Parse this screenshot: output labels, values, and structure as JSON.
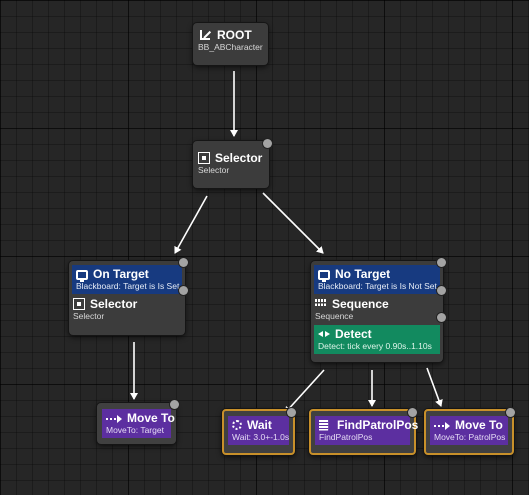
{
  "nodes": {
    "root": {
      "title": "ROOT",
      "subtitle": "BB_ABCharacter",
      "icon": "root-icon"
    },
    "selector_main": {
      "title": "Selector",
      "subtitle": "Selector",
      "icon": "selector-icon"
    },
    "left_branch": {
      "decorator": {
        "title": "On Target",
        "subtitle": "Blackboard: Target is Is Set",
        "icon": "blackboard-icon"
      },
      "composite": {
        "title": "Selector",
        "subtitle": "Selector",
        "icon": "selector-icon"
      }
    },
    "right_branch": {
      "decorator": {
        "title": "No Target",
        "subtitle": "Blackboard: Target is Is Not Set",
        "icon": "blackboard-icon"
      },
      "composite": {
        "title": "Sequence",
        "subtitle": "Sequence",
        "icon": "sequence-icon"
      },
      "service": {
        "title": "Detect",
        "subtitle": "Detect: tick every 0.90s..1.10s",
        "icon": "service-icon"
      }
    },
    "tasks": {
      "move_to_target": {
        "title": "Move To",
        "subtitle": "MoveTo: Target",
        "icon": "move-to-icon"
      },
      "wait": {
        "title": "Wait",
        "subtitle": "Wait: 3.0+-1.0s",
        "icon": "wait-icon"
      },
      "find_patrol_pos": {
        "title": "FindPatrolPos",
        "subtitle": "FindPatrolPos",
        "icon": "task-icon"
      },
      "move_to_patrol": {
        "title": "Move To",
        "subtitle": "MoveTo: PatrolPos",
        "icon": "move-to-icon"
      }
    }
  },
  "colors": {
    "background": "#262626",
    "node": "#3c3c3c",
    "decorator": "#173a80",
    "service": "#128a5f",
    "task": "#5c2fa0",
    "active_outline": "#c8902a",
    "wire": "#ffffff"
  }
}
